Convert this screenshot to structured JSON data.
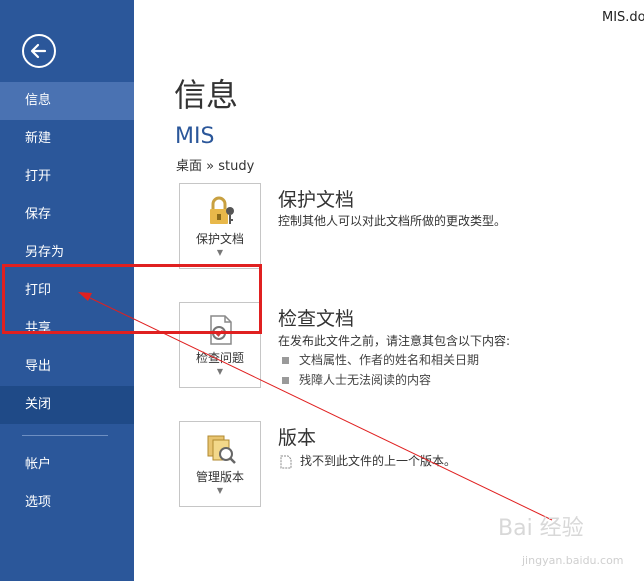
{
  "window": {
    "file_name": "MIS.do"
  },
  "sidebar": {
    "items": [
      {
        "label": "信息"
      },
      {
        "label": "新建"
      },
      {
        "label": "打开"
      },
      {
        "label": "保存"
      },
      {
        "label": "另存为"
      },
      {
        "label": "打印"
      },
      {
        "label": "共享"
      },
      {
        "label": "导出"
      },
      {
        "label": "关闭"
      },
      {
        "label": "帐户"
      },
      {
        "label": "选项"
      }
    ]
  },
  "main": {
    "title": "信息",
    "doc_name": "MIS",
    "doc_path": "桌面 » study",
    "protect": {
      "tile_label": "保护文档",
      "title": "保护文档",
      "desc": "控制其他人可以对此文档所做的更改类型。"
    },
    "inspect": {
      "tile_label": "检查问题",
      "title": "检查文档",
      "desc": "在发布此文件之前，请注意其包含以下内容:",
      "bullets": [
        "文档属性、作者的姓名和相关日期",
        "残障人士无法阅读的内容"
      ]
    },
    "versions": {
      "tile_label": "管理版本",
      "title": "版本",
      "desc": "找不到此文件的上一个版本。"
    }
  },
  "watermark": {
    "brand": "Bai 经验",
    "url": "jingyan.baidu.com"
  },
  "colors": {
    "sidebar": "#2b579a",
    "selected": "#4a72b2",
    "accent": "#2b579a",
    "annotation": "#e02020"
  }
}
